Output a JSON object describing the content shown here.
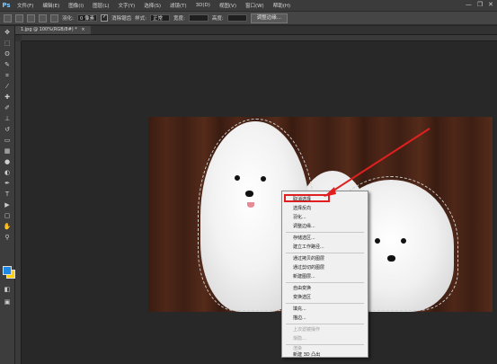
{
  "app": {
    "logo": "Ps",
    "menu": [
      "文件(F)",
      "编辑(E)",
      "图像(I)",
      "图层(L)",
      "文字(Y)",
      "选择(S)",
      "滤镜(T)",
      "3D(D)",
      "视图(V)",
      "窗口(W)",
      "帮助(H)"
    ],
    "window_controls": [
      "—",
      "❐",
      "✕"
    ]
  },
  "options_bar": {
    "feather_label": "羽化:",
    "feather_value": "0 像素",
    "antialias_label": "消除锯齿",
    "style_label": "样式:",
    "style_value": "正常",
    "width_label": "宽度:",
    "height_label": "高度:",
    "refine_button": "调整边缘..."
  },
  "document": {
    "tab_label": "1.jpg @ 100%(RGB/8#) *",
    "close_symbol": "×"
  },
  "context_menu": {
    "items": [
      {
        "label": "取消选择",
        "disabled": false
      },
      {
        "label": "选择反向",
        "disabled": false
      },
      {
        "label": "羽化...",
        "disabled": false
      },
      {
        "label": "调整边缘...",
        "disabled": false
      },
      {
        "label": "存储选区...",
        "disabled": false
      },
      {
        "label": "建立工作路径...",
        "disabled": false
      },
      {
        "label": "通过拷贝的图层",
        "disabled": false
      },
      {
        "label": "通过剪切的图层",
        "disabled": false
      },
      {
        "label": "新建图层...",
        "disabled": false
      },
      {
        "label": "自由变换",
        "disabled": false
      },
      {
        "label": "变换选区",
        "disabled": false
      },
      {
        "label": "填充...",
        "disabled": false
      },
      {
        "label": "描边...",
        "disabled": false
      },
      {
        "label": "上次滤镜操作",
        "disabled": true
      },
      {
        "label": "渐隐...",
        "disabled": true
      },
      {
        "label": "渲染",
        "disabled": true
      },
      {
        "label": "新建 3D 凸出",
        "disabled": false
      }
    ]
  },
  "colors": {
    "foreground": "#1e88e5",
    "background": "#ffd200",
    "annotation": "#e02020"
  }
}
